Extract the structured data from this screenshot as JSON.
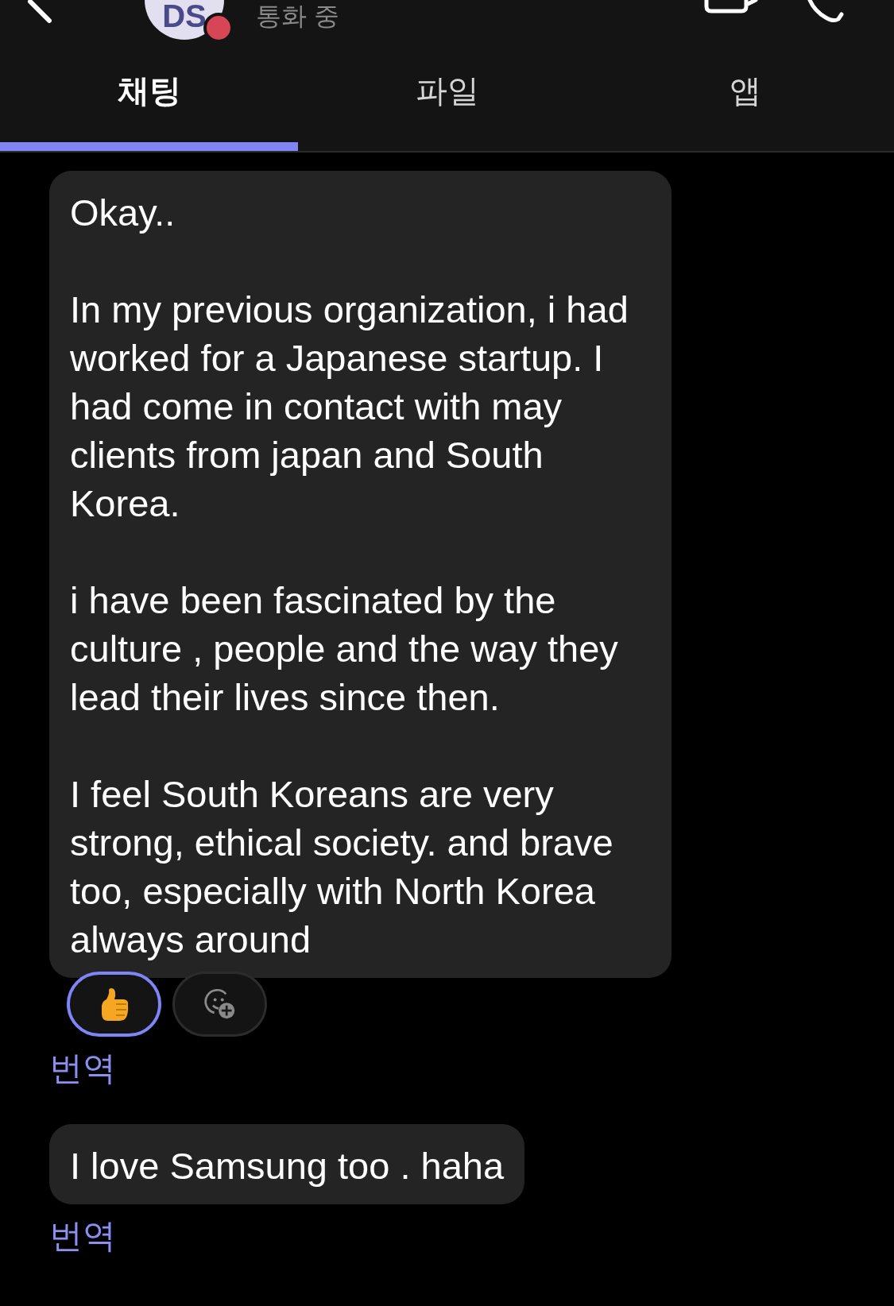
{
  "header": {
    "avatar_initials": "DS",
    "busy": true,
    "status": "통화 중"
  },
  "tabs": [
    {
      "label": "채팅",
      "selected": true
    },
    {
      "label": "파일",
      "selected": false
    },
    {
      "label": "앱",
      "selected": false
    }
  ],
  "messages": [
    {
      "paragraphs": [
        "Okay..",
        "In my previous organization, i had worked for a Japanese startup. I had come in contact with may clients from japan and South Korea.",
        "i have been fascinated by the culture , people and the way they lead their lives since then.",
        "I feel South Koreans are very strong, ethical society. and brave too, especially with North Korea always around"
      ],
      "reactions": [
        {
          "kind": "thumbs_up",
          "selected": true
        }
      ],
      "translate": "번역"
    },
    {
      "paragraphs": [
        "I love Samsung too . haha"
      ],
      "translate": "번역"
    }
  ]
}
